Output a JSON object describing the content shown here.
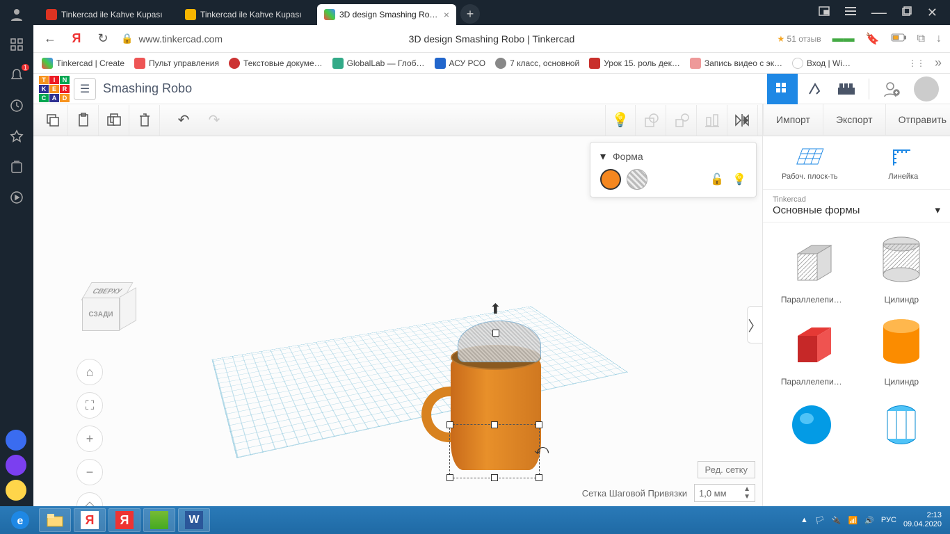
{
  "browser": {
    "tabs": [
      {
        "label": "Tinkercad ile Kahve Kupası",
        "favcolor": "#dd3322"
      },
      {
        "label": "Tinkercad ile Kahve Kupası",
        "favcolor": "#f7b500"
      },
      {
        "label": "3D design Smashing Ro…",
        "favcolor": "#4cc"
      }
    ],
    "active_tab_index": 2,
    "url": "www.tinkercad.com",
    "page_title": "3D design Smashing Robo | Tinkercad",
    "rating": "51 отзыв",
    "bookmarks": [
      {
        "label": "Tinkercad | Create",
        "color": "#4cc"
      },
      {
        "label": "Пульт управления",
        "color": "#e55"
      },
      {
        "label": "Текстовые докуме…",
        "color": "#c33"
      },
      {
        "label": "GlobalLab — Глоб…",
        "color": "#3a8"
      },
      {
        "label": "АСУ РСО",
        "color": "#26c"
      },
      {
        "label": "7 класс, основной",
        "color": "#888"
      },
      {
        "label": "Урок 15. роль дек…",
        "color": "#c9302c"
      },
      {
        "label": "Запись видео с эк…",
        "color": "#e99"
      },
      {
        "label": "Вход | Wi…",
        "color": "#fff"
      }
    ]
  },
  "tinkercad": {
    "project_name": "Smashing Robo",
    "toolbar_right": {
      "import": "Импорт",
      "export": "Экспорт",
      "send": "Отправить"
    },
    "viewcube": {
      "top": "СВЕРХУ",
      "front": "СЗАДИ"
    },
    "shape_panel": {
      "title": "Форма"
    },
    "right_panel": {
      "workplane": "Рабоч. плоск-ть",
      "ruler": "Линейка",
      "category_group": "Tinkercad",
      "category": "Основные формы",
      "shapes": [
        {
          "name": "Параллелепи…"
        },
        {
          "name": "Цилиндр"
        },
        {
          "name": "Параллелепи…"
        },
        {
          "name": "Цилиндр"
        }
      ]
    },
    "footer": {
      "edit_grid": "Ред. сетку",
      "snap_label": "Сетка Шаговой Привязки",
      "snap_value": "1,0 мм"
    }
  },
  "taskbar": {
    "lang": "РУС",
    "time": "2:13",
    "date": "09.04.2020"
  },
  "sidebar_badge": "1"
}
